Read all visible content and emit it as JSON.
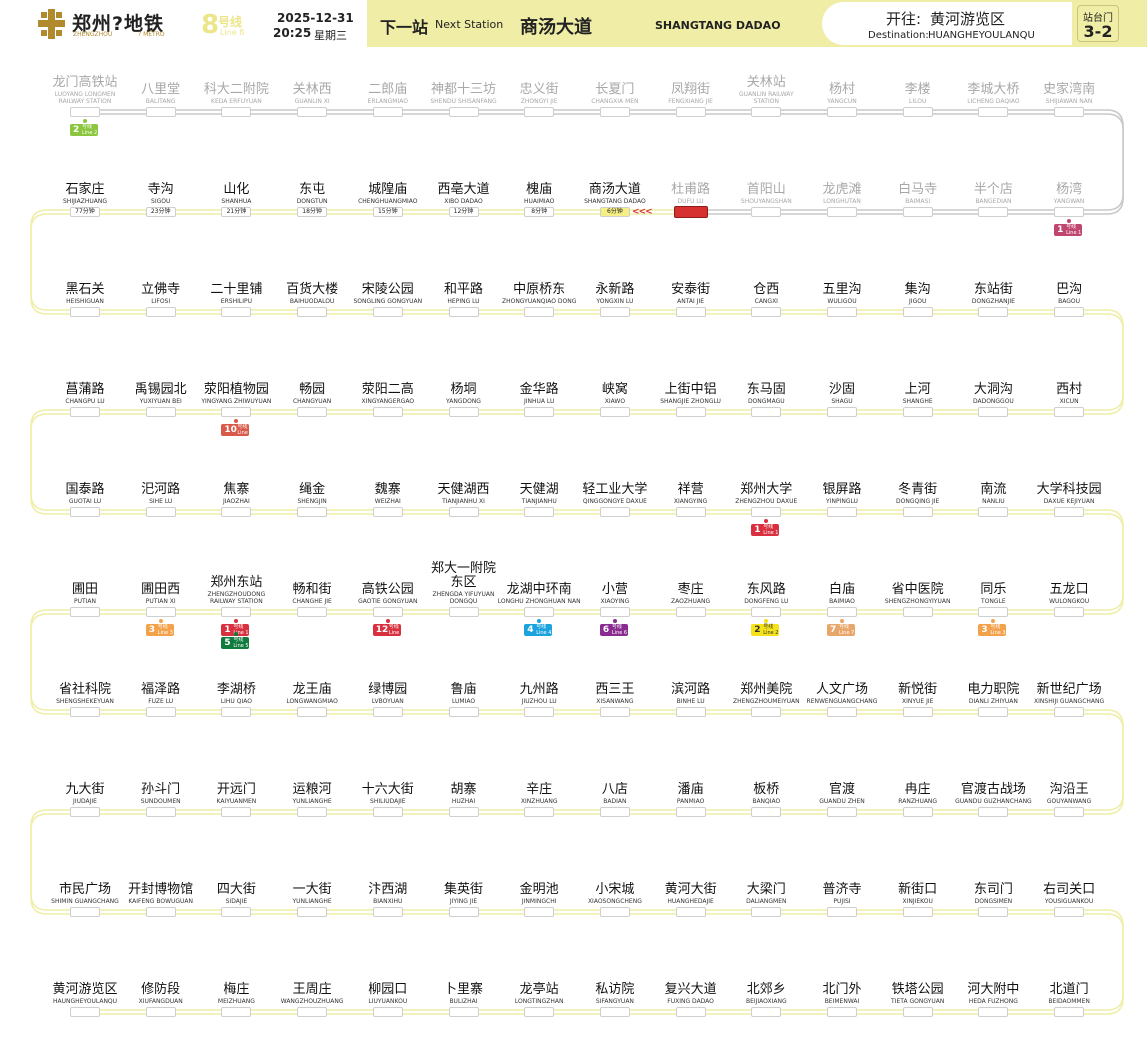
{
  "header": {
    "logo_cn": "郑州?地铁",
    "logo_en_left": "ZHENGZHOU",
    "logo_en_right": "? METRO",
    "line_number": "8",
    "line_cn": "号线",
    "line_en": "Line 8",
    "date": "2025-12-31",
    "time": "20:25",
    "weekday": "星期三",
    "next_station_label_cn": "下一站",
    "next_station_label_en": "Next Station",
    "next_station_cn": "商汤大道",
    "next_station_en": "SHANGTANG DADAO",
    "destination_label_cn": "开往:",
    "destination_cn": "黄河游览区",
    "destination_label_en": "Destination:",
    "destination_en": "HUANGHEYOULANQU",
    "door_label": "站台门",
    "door_value": "3-2"
  },
  "colors": {
    "line": "#f0eea6",
    "track_passed": "#c8c8c8",
    "current": "#d6302f",
    "line1": "#c1466f",
    "line2": "#8cc63f",
    "line3": "#f3a14b",
    "line4": "#1ca3dd",
    "line5": "#0f7b3e",
    "line6": "#8a2b8f",
    "line7": "#e9a66a",
    "line10": "#d85a4a",
    "line12": "#d8303f"
  },
  "rows": [
    {
      "stations": [
        {
          "cn": "龙门高铁站",
          "en": "LUOYANG LONGMEN RAILWAY STATION",
          "passed": true,
          "transfers": [
            {
              "num": "2",
              "label": "号线",
              "sub": "Line 2",
              "color": "#8cc63f"
            }
          ]
        },
        {
          "cn": "八里堂",
          "en": "BALITANG",
          "passed": true
        },
        {
          "cn": "科大二附院",
          "en": "KEDA ERFUYUAN",
          "passed": true
        },
        {
          "cn": "关林西",
          "en": "GUANLIN XI",
          "passed": true
        },
        {
          "cn": "二郎庙",
          "en": "ERLANGMIAO",
          "passed": true
        },
        {
          "cn": "神都十三坊",
          "en": "SHENDU SHISANFANG",
          "passed": true
        },
        {
          "cn": "忠义街",
          "en": "ZHONGYI JIE",
          "passed": true
        },
        {
          "cn": "长夏门",
          "en": "CHANGXIA MEN",
          "passed": true
        },
        {
          "cn": "凤翔街",
          "en": "FENGXIANG JIE",
          "passed": true
        },
        {
          "cn": "关林站",
          "en": "GUANLIN RAILWAY STATION",
          "passed": true
        },
        {
          "cn": "杨村",
          "en": "YANGCUN",
          "passed": true
        },
        {
          "cn": "李楼",
          "en": "LILOU",
          "passed": true
        },
        {
          "cn": "李城大桥",
          "en": "LICHENG DAQIAO",
          "passed": true
        },
        {
          "cn": "史家湾南",
          "en": "SHIJIAWAN NAN",
          "passed": true
        }
      ]
    },
    {
      "stations": [
        {
          "cn": "石家庄",
          "en": "SHIJIAZHUANG",
          "time": "77分钟"
        },
        {
          "cn": "寺沟",
          "en": "SIGOU",
          "time": "23分钟"
        },
        {
          "cn": "山化",
          "en": "SHANHUA",
          "time": "21分钟"
        },
        {
          "cn": "东屯",
          "en": "DONGTUN",
          "time": "18分钟"
        },
        {
          "cn": "城隍庙",
          "en": "CHENGHUANGMIAO",
          "time": "15分钟"
        },
        {
          "cn": "西亳大道",
          "en": "XIBO DADAO",
          "time": "12分钟"
        },
        {
          "cn": "槐庙",
          "en": "HUAIMIAO",
          "time": "8分钟"
        },
        {
          "cn": "商汤大道",
          "en": "SHANGTANG DADAO",
          "time": "6分钟",
          "next": true
        },
        {
          "cn": "杜甫路",
          "en": "DUFU LU",
          "passed": true,
          "current": true
        },
        {
          "cn": "首阳山",
          "en": "SHOUYANGSHAN",
          "passed": true
        },
        {
          "cn": "龙虎滩",
          "en": "LONGHUTAN",
          "passed": true
        },
        {
          "cn": "白马寺",
          "en": "BAIMASI",
          "passed": true
        },
        {
          "cn": "半个店",
          "en": "BANGEDIAN",
          "passed": true
        },
        {
          "cn": "杨湾",
          "en": "YANGWAN",
          "passed": true,
          "transfers": [
            {
              "num": "1",
              "label": "号线",
              "sub": "Line 1",
              "color": "#c1466f"
            }
          ]
        }
      ]
    },
    {
      "stations": [
        {
          "cn": "黑石关",
          "en": "HEISHIGUAN"
        },
        {
          "cn": "立佛寺",
          "en": "LIFOSI"
        },
        {
          "cn": "二十里铺",
          "en": "ERSHILIPU"
        },
        {
          "cn": "百货大楼",
          "en": "BAIHUODALOU"
        },
        {
          "cn": "宋陵公园",
          "en": "SONGLING GONGYUAN"
        },
        {
          "cn": "和平路",
          "en": "HEPING LU"
        },
        {
          "cn": "中原桥东",
          "en": "ZHONGYUANQIAO DONG"
        },
        {
          "cn": "永新路",
          "en": "YONGXIN LU"
        },
        {
          "cn": "安泰街",
          "en": "ANTAI JIE"
        },
        {
          "cn": "仓西",
          "en": "CANGXI"
        },
        {
          "cn": "五里沟",
          "en": "WULIGOU"
        },
        {
          "cn": "集沟",
          "en": "JIGOU"
        },
        {
          "cn": "东站街",
          "en": "DONGZHANJIE"
        },
        {
          "cn": "巴沟",
          "en": "BAGOU"
        }
      ]
    },
    {
      "stations": [
        {
          "cn": "菖蒲路",
          "en": "CHANGPU LU"
        },
        {
          "cn": "禹锡园北",
          "en": "YUXIYUAN BEI"
        },
        {
          "cn": "荥阳植物园",
          "en": "YINGYANG ZHIWUYUAN",
          "transfers": [
            {
              "num": "10",
              "label": "号线",
              "sub": "Line 10",
              "color": "#d85a4a"
            }
          ]
        },
        {
          "cn": "畅园",
          "en": "CHANGYUAN"
        },
        {
          "cn": "荥阳二高",
          "en": "XINGYANGERGAO"
        },
        {
          "cn": "杨垌",
          "en": "YANGDONG"
        },
        {
          "cn": "金华路",
          "en": "JINHUA LU"
        },
        {
          "cn": "峡窝",
          "en": "XIAWO"
        },
        {
          "cn": "上街中铝",
          "en": "SHANGJIE ZHONGLU"
        },
        {
          "cn": "东马固",
          "en": "DONGMAGU"
        },
        {
          "cn": "沙固",
          "en": "SHAGU"
        },
        {
          "cn": "上河",
          "en": "SHANGHE"
        },
        {
          "cn": "大洞沟",
          "en": "DADONGGOU"
        },
        {
          "cn": "西村",
          "en": "XICUN"
        }
      ]
    },
    {
      "stations": [
        {
          "cn": "国泰路",
          "en": "GUOTAI LU"
        },
        {
          "cn": "汜河路",
          "en": "SIHE LU"
        },
        {
          "cn": "焦寨",
          "en": "JIAOZHAI"
        },
        {
          "cn": "绳金",
          "en": "SHENGJIN"
        },
        {
          "cn": "魏寨",
          "en": "WEIZHAI"
        },
        {
          "cn": "天健湖西",
          "en": "TIANJIANHU XI"
        },
        {
          "cn": "天健湖",
          "en": "TIANJIANHU"
        },
        {
          "cn": "轻工业大学",
          "en": "QINGGONGYE DAXUE"
        },
        {
          "cn": "祥营",
          "en": "XIANGYING"
        },
        {
          "cn": "郑州大学",
          "en": "ZHENGZHOU DAXUE",
          "transfers": [
            {
              "num": "1",
              "label": "号线",
              "sub": "Line 1",
              "color": "#d8303f"
            }
          ]
        },
        {
          "cn": "银屏路",
          "en": "YINPINGLU"
        },
        {
          "cn": "冬青街",
          "en": "DONGQING JIE"
        },
        {
          "cn": "南流",
          "en": "NANLIU"
        },
        {
          "cn": "大学科技园",
          "en": "DAXUE KEJIYUAN"
        }
      ]
    },
    {
      "stations": [
        {
          "cn": "圃田",
          "en": "PUTIAN"
        },
        {
          "cn": "圃田西",
          "en": "PUTIAN XI",
          "transfers": [
            {
              "num": "3",
              "label": "号线",
              "sub": "Line 3",
              "color": "#f3a14b"
            }
          ]
        },
        {
          "cn": "郑州东站",
          "en": "ZHENGZHOUDONG RAILWAY STATION",
          "transfers": [
            {
              "num": "1",
              "label": "号线",
              "sub": "Line 1",
              "color": "#d8303f"
            },
            {
              "num": "5",
              "label": "号线",
              "sub": "Line 5",
              "color": "#0f7b3e"
            }
          ]
        },
        {
          "cn": "畅和街",
          "en": "CHANGHE JIE"
        },
        {
          "cn": "高铁公园",
          "en": "GAOTIE GONGYUAN",
          "transfers": [
            {
              "num": "12",
              "label": "号线",
              "sub": "Line 12",
              "color": "#d8303f"
            }
          ]
        },
        {
          "cn": "郑大一附院东区",
          "en": "ZHENGDA YIFUYUAN DONGQU"
        },
        {
          "cn": "龙湖中环南",
          "en": "LONGHU ZHONGHUAN NAN",
          "transfers": [
            {
              "num": "4",
              "label": "号线",
              "sub": "Line 4",
              "color": "#1ca3dd"
            }
          ]
        },
        {
          "cn": "小营",
          "en": "XIAOYING",
          "transfers": [
            {
              "num": "6",
              "label": "号线",
              "sub": "Line 6",
              "color": "#8a2b8f"
            }
          ]
        },
        {
          "cn": "枣庄",
          "en": "ZAOZHUANG"
        },
        {
          "cn": "东风路",
          "en": "DONGFENG LU",
          "transfers": [
            {
              "num": "2",
              "label": "号线",
              "sub": "Line 2",
              "color": "#f5e21a",
              "dark": true
            }
          ]
        },
        {
          "cn": "白庙",
          "en": "BAIMIAO",
          "transfers": [
            {
              "num": "7",
              "label": "号线",
              "sub": "Line 7",
              "color": "#e9a66a"
            }
          ]
        },
        {
          "cn": "省中医院",
          "en": "SHENGZHONGYIYUAN"
        },
        {
          "cn": "同乐",
          "en": "TONGLE",
          "transfers": [
            {
              "num": "3",
              "label": "号线",
              "sub": "Line 3",
              "color": "#f3a14b"
            }
          ]
        },
        {
          "cn": "五龙口",
          "en": "WULONGKOU"
        }
      ]
    },
    {
      "stations": [
        {
          "cn": "省社科院",
          "en": "SHENGSHEKEYUAN"
        },
        {
          "cn": "福泽路",
          "en": "FUZE LU"
        },
        {
          "cn": "李湖桥",
          "en": "LIHU QIAO"
        },
        {
          "cn": "龙王庙",
          "en": "LONGWANGMIAO"
        },
        {
          "cn": "绿博园",
          "en": "LVBOYUAN"
        },
        {
          "cn": "鲁庙",
          "en": "LUMIAO"
        },
        {
          "cn": "九州路",
          "en": "JIUZHOU LU"
        },
        {
          "cn": "西三王",
          "en": "XISANWANG"
        },
        {
          "cn": "滨河路",
          "en": "BINHE LU"
        },
        {
          "cn": "郑州美院",
          "en": "ZHENGZHOUMEIYUAN"
        },
        {
          "cn": "人文广场",
          "en": "RENWENGUANGCHANG"
        },
        {
          "cn": "新悦街",
          "en": "XINYUE JIE"
        },
        {
          "cn": "电力职院",
          "en": "DIANLI ZHIYUAN"
        },
        {
          "cn": "新世纪广场",
          "en": "XINSHIJI GUANGCHANG"
        }
      ]
    },
    {
      "stations": [
        {
          "cn": "九大街",
          "en": "JIUDAJIE"
        },
        {
          "cn": "孙斗门",
          "en": "SUNDOUMEN"
        },
        {
          "cn": "开远门",
          "en": "KAIYUANMEN"
        },
        {
          "cn": "运粮河",
          "en": "YUNLIANGHE"
        },
        {
          "cn": "十六大街",
          "en": "SHILIUDAJIE"
        },
        {
          "cn": "胡寨",
          "en": "HUZHAI"
        },
        {
          "cn": "辛庄",
          "en": "XINZHUANG"
        },
        {
          "cn": "八店",
          "en": "BADIAN"
        },
        {
          "cn": "潘庙",
          "en": "PANMIAO"
        },
        {
          "cn": "板桥",
          "en": "BANQIAO"
        },
        {
          "cn": "官渡",
          "en": "GUANDU ZHEN"
        },
        {
          "cn": "冉庄",
          "en": "RANZHUANG"
        },
        {
          "cn": "官渡古战场",
          "en": "GUANDU GUZHANCHANG"
        },
        {
          "cn": "沟沿王",
          "en": "GOUYANWANG"
        }
      ]
    },
    {
      "stations": [
        {
          "cn": "市民广场",
          "en": "SHIMIN GUANGCHANG"
        },
        {
          "cn": "开封博物馆",
          "en": "KAIFENG BOWUGUAN"
        },
        {
          "cn": "四大街",
          "en": "SIDAJIE"
        },
        {
          "cn": "一大街",
          "en": "YUNLIANGHE"
        },
        {
          "cn": "汴西湖",
          "en": "BIANXIHU"
        },
        {
          "cn": "集英街",
          "en": "JIYING JIE"
        },
        {
          "cn": "金明池",
          "en": "JINMINGCHI"
        },
        {
          "cn": "小宋城",
          "en": "XIAOSONGCHENG"
        },
        {
          "cn": "黄河大街",
          "en": "HUANGHEDAJIE"
        },
        {
          "cn": "大梁门",
          "en": "DALIANGMEN"
        },
        {
          "cn": "普济寺",
          "en": "PUJISI"
        },
        {
          "cn": "新街口",
          "en": "XINJIEKOU"
        },
        {
          "cn": "东司门",
          "en": "DONGSIMEN"
        },
        {
          "cn": "右司关口",
          "en": "YOUSIGUANKOU"
        }
      ]
    },
    {
      "stations": [
        {
          "cn": "黄河游览区",
          "en": "HAUNGHEYOULANQU"
        },
        {
          "cn": "修防段",
          "en": "XIUFANGDUAN"
        },
        {
          "cn": "梅庄",
          "en": "MEIZHUANG"
        },
        {
          "cn": "王周庄",
          "en": "WANGZHOUZHUANG"
        },
        {
          "cn": "柳园口",
          "en": "LIUYUANKOU"
        },
        {
          "cn": "卜里寨",
          "en": "BULIZHAI"
        },
        {
          "cn": "龙亭站",
          "en": "LONGTINGZHAN"
        },
        {
          "cn": "私访院",
          "en": "SIFANGYUAN"
        },
        {
          "cn": "复兴大道",
          "en": "FUXING DADAO"
        },
        {
          "cn": "北郊乡",
          "en": "BEIJIAOXIANG"
        },
        {
          "cn": "北门外",
          "en": "BEIMENWAI"
        },
        {
          "cn": "铁塔公园",
          "en": "TIETA GONGYUAN"
        },
        {
          "cn": "河大附中",
          "en": "HEDA FUZHONG"
        },
        {
          "cn": "北道门",
          "en": "BEIDAOMMEN"
        }
      ]
    }
  ],
  "arrows": "<<<"
}
